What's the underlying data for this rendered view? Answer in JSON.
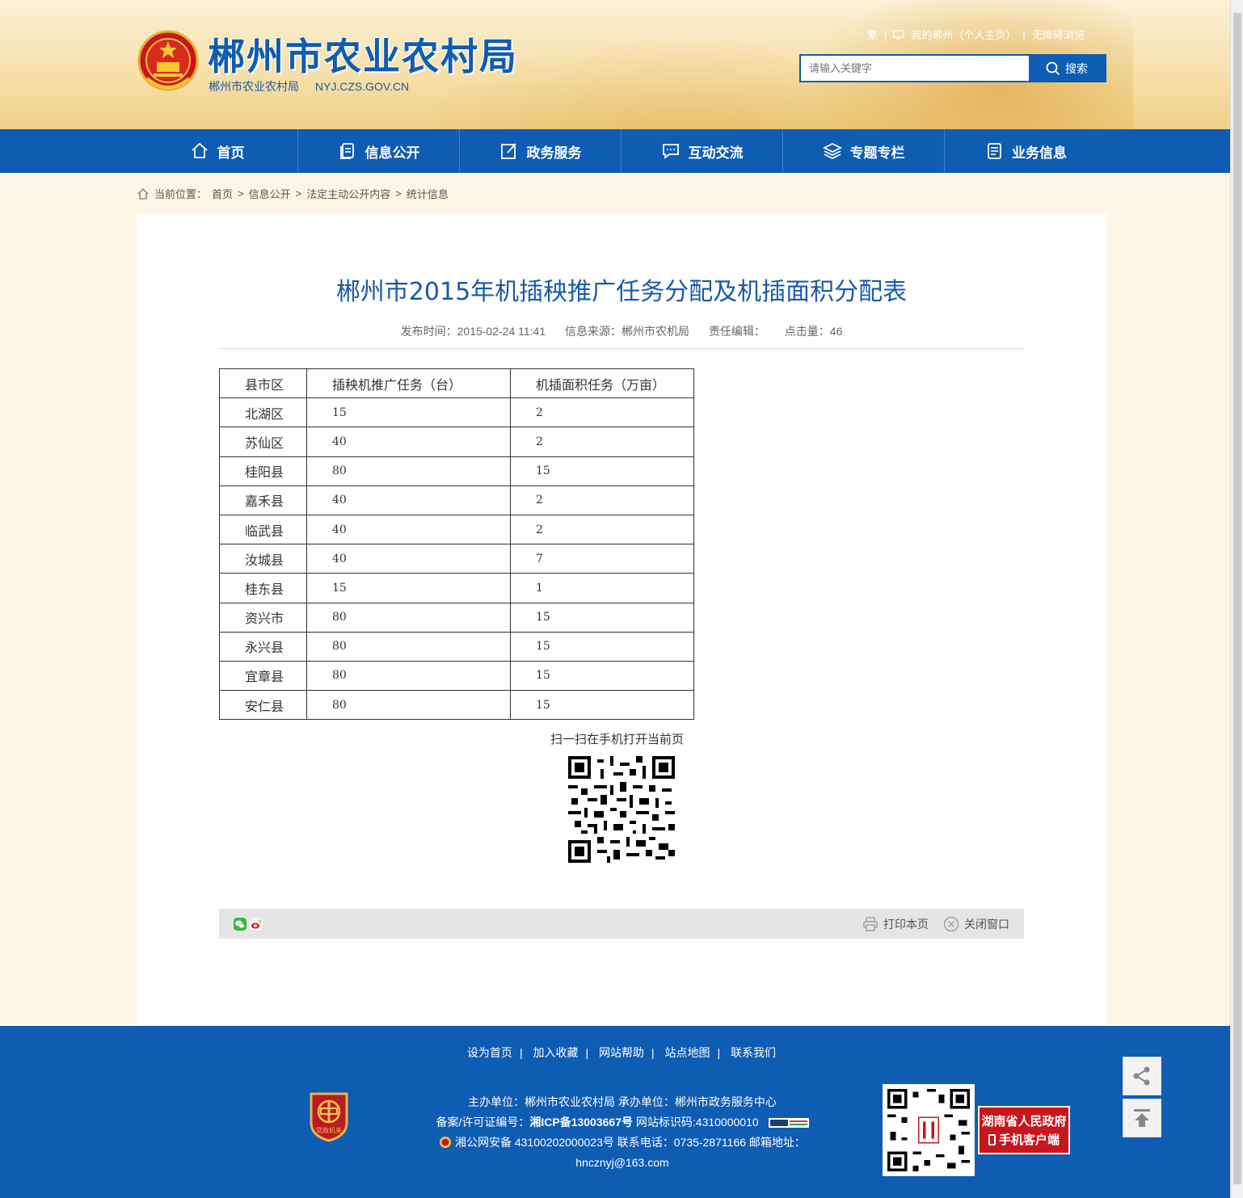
{
  "header": {
    "site_title": "郴州市农业农村局",
    "site_sub_name": "郴州市农业农村局",
    "site_domain": "NYJ.CZS.GOV.CN",
    "toplinks": {
      "traditional": "繁",
      "my_chenzhou": "我的郴州（个人主页）",
      "accessible": "无障碍浏览"
    },
    "search": {
      "placeholder": "请输入关键字",
      "button_label": "搜索"
    }
  },
  "nav": {
    "items": [
      {
        "label": "首页",
        "icon": "home-icon"
      },
      {
        "label": "信息公开",
        "icon": "document-icon"
      },
      {
        "label": "政务服务",
        "icon": "edit-icon"
      },
      {
        "label": "互动交流",
        "icon": "chat-icon"
      },
      {
        "label": "专题专栏",
        "icon": "layers-icon"
      },
      {
        "label": "业务信息",
        "icon": "file-list-icon"
      }
    ]
  },
  "breadcrumb": {
    "prefix": "当前位置：",
    "items": [
      "首页",
      "信息公开",
      "法定主动公开内容",
      "统计信息"
    ],
    "separator": ">"
  },
  "article": {
    "title": "郴州市2015年机插秧推广任务分配及机插面积分配表",
    "meta": {
      "publish_time": "发布时间：2015-02-24 11:41",
      "source": "信息来源：郴州市农机局",
      "editor": "责任编辑：",
      "clicks": "点击量：46"
    },
    "table": {
      "headers": [
        "县市区",
        "插秧机推广任务（台）",
        "机插面积任务（万亩）"
      ],
      "rows": [
        [
          "北湖区",
          "15",
          "2"
        ],
        [
          "苏仙区",
          "40",
          "2"
        ],
        [
          "桂阳县",
          "80",
          "15"
        ],
        [
          "嘉禾县",
          "40",
          "2"
        ],
        [
          "临武县",
          "40",
          "2"
        ],
        [
          "汝城县",
          "40",
          "7"
        ],
        [
          "桂东县",
          "15",
          "1"
        ],
        [
          "资兴市",
          "80",
          "15"
        ],
        [
          "永兴县",
          "80",
          "15"
        ],
        [
          "宜章县",
          "80",
          "15"
        ],
        [
          "安仁县",
          "80",
          "15"
        ]
      ]
    },
    "qr_caption": "扫一扫在手机打开当前页",
    "share_bar": {
      "print_label": "打印本页",
      "close_label": "关闭窗口"
    }
  },
  "footer": {
    "links": [
      "设为首页",
      "加入收藏",
      "网站帮助",
      "站点地图",
      "联系我们"
    ],
    "line1": "主办单位：郴州市农业农村局   承办单位：郴州市政务服务中心",
    "line2_prefix": "备案/许可证编号：",
    "icp": "湘ICP备13003667号",
    "line2_suffix": "   网站标识码:4310000010",
    "line3": "湘公网安备 43100202000023号   联系电话：0735-2871166   邮箱地址：",
    "line4": "hncznyj@163.com",
    "badge_text": "党政机关",
    "app_badge_line1": "湖南省人民政府",
    "app_badge_line2": "手机客户端"
  },
  "colors": {
    "brand_blue": "#0f5cb3",
    "title_blue": "#1a5aa8",
    "app_red": "#c8161d"
  }
}
